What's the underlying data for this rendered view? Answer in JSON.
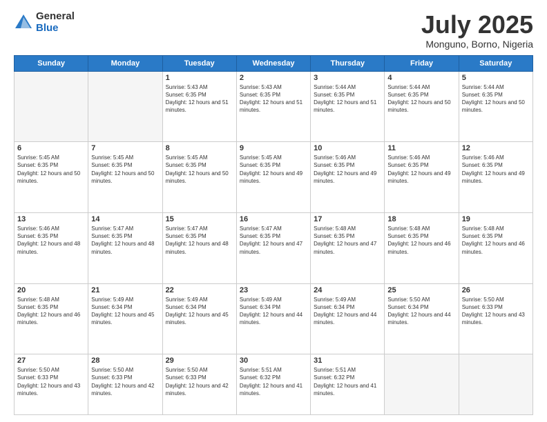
{
  "header": {
    "logo_general": "General",
    "logo_blue": "Blue",
    "month_title": "July 2025",
    "location": "Monguno, Borno, Nigeria"
  },
  "calendar": {
    "days_of_week": [
      "Sunday",
      "Monday",
      "Tuesday",
      "Wednesday",
      "Thursday",
      "Friday",
      "Saturday"
    ],
    "weeks": [
      [
        {
          "day": "",
          "sunrise": "",
          "sunset": "",
          "daylight": "",
          "empty": true
        },
        {
          "day": "",
          "sunrise": "",
          "sunset": "",
          "daylight": "",
          "empty": true
        },
        {
          "day": "1",
          "sunrise": "Sunrise: 5:43 AM",
          "sunset": "Sunset: 6:35 PM",
          "daylight": "Daylight: 12 hours and 51 minutes.",
          "empty": false
        },
        {
          "day": "2",
          "sunrise": "Sunrise: 5:43 AM",
          "sunset": "Sunset: 6:35 PM",
          "daylight": "Daylight: 12 hours and 51 minutes.",
          "empty": false
        },
        {
          "day": "3",
          "sunrise": "Sunrise: 5:44 AM",
          "sunset": "Sunset: 6:35 PM",
          "daylight": "Daylight: 12 hours and 51 minutes.",
          "empty": false
        },
        {
          "day": "4",
          "sunrise": "Sunrise: 5:44 AM",
          "sunset": "Sunset: 6:35 PM",
          "daylight": "Daylight: 12 hours and 50 minutes.",
          "empty": false
        },
        {
          "day": "5",
          "sunrise": "Sunrise: 5:44 AM",
          "sunset": "Sunset: 6:35 PM",
          "daylight": "Daylight: 12 hours and 50 minutes.",
          "empty": false
        }
      ],
      [
        {
          "day": "6",
          "sunrise": "Sunrise: 5:45 AM",
          "sunset": "Sunset: 6:35 PM",
          "daylight": "Daylight: 12 hours and 50 minutes.",
          "empty": false
        },
        {
          "day": "7",
          "sunrise": "Sunrise: 5:45 AM",
          "sunset": "Sunset: 6:35 PM",
          "daylight": "Daylight: 12 hours and 50 minutes.",
          "empty": false
        },
        {
          "day": "8",
          "sunrise": "Sunrise: 5:45 AM",
          "sunset": "Sunset: 6:35 PM",
          "daylight": "Daylight: 12 hours and 50 minutes.",
          "empty": false
        },
        {
          "day": "9",
          "sunrise": "Sunrise: 5:45 AM",
          "sunset": "Sunset: 6:35 PM",
          "daylight": "Daylight: 12 hours and 49 minutes.",
          "empty": false
        },
        {
          "day": "10",
          "sunrise": "Sunrise: 5:46 AM",
          "sunset": "Sunset: 6:35 PM",
          "daylight": "Daylight: 12 hours and 49 minutes.",
          "empty": false
        },
        {
          "day": "11",
          "sunrise": "Sunrise: 5:46 AM",
          "sunset": "Sunset: 6:35 PM",
          "daylight": "Daylight: 12 hours and 49 minutes.",
          "empty": false
        },
        {
          "day": "12",
          "sunrise": "Sunrise: 5:46 AM",
          "sunset": "Sunset: 6:35 PM",
          "daylight": "Daylight: 12 hours and 49 minutes.",
          "empty": false
        }
      ],
      [
        {
          "day": "13",
          "sunrise": "Sunrise: 5:46 AM",
          "sunset": "Sunset: 6:35 PM",
          "daylight": "Daylight: 12 hours and 48 minutes.",
          "empty": false
        },
        {
          "day": "14",
          "sunrise": "Sunrise: 5:47 AM",
          "sunset": "Sunset: 6:35 PM",
          "daylight": "Daylight: 12 hours and 48 minutes.",
          "empty": false
        },
        {
          "day": "15",
          "sunrise": "Sunrise: 5:47 AM",
          "sunset": "Sunset: 6:35 PM",
          "daylight": "Daylight: 12 hours and 48 minutes.",
          "empty": false
        },
        {
          "day": "16",
          "sunrise": "Sunrise: 5:47 AM",
          "sunset": "Sunset: 6:35 PM",
          "daylight": "Daylight: 12 hours and 47 minutes.",
          "empty": false
        },
        {
          "day": "17",
          "sunrise": "Sunrise: 5:48 AM",
          "sunset": "Sunset: 6:35 PM",
          "daylight": "Daylight: 12 hours and 47 minutes.",
          "empty": false
        },
        {
          "day": "18",
          "sunrise": "Sunrise: 5:48 AM",
          "sunset": "Sunset: 6:35 PM",
          "daylight": "Daylight: 12 hours and 46 minutes.",
          "empty": false
        },
        {
          "day": "19",
          "sunrise": "Sunrise: 5:48 AM",
          "sunset": "Sunset: 6:35 PM",
          "daylight": "Daylight: 12 hours and 46 minutes.",
          "empty": false
        }
      ],
      [
        {
          "day": "20",
          "sunrise": "Sunrise: 5:48 AM",
          "sunset": "Sunset: 6:35 PM",
          "daylight": "Daylight: 12 hours and 46 minutes.",
          "empty": false
        },
        {
          "day": "21",
          "sunrise": "Sunrise: 5:49 AM",
          "sunset": "Sunset: 6:34 PM",
          "daylight": "Daylight: 12 hours and 45 minutes.",
          "empty": false
        },
        {
          "day": "22",
          "sunrise": "Sunrise: 5:49 AM",
          "sunset": "Sunset: 6:34 PM",
          "daylight": "Daylight: 12 hours and 45 minutes.",
          "empty": false
        },
        {
          "day": "23",
          "sunrise": "Sunrise: 5:49 AM",
          "sunset": "Sunset: 6:34 PM",
          "daylight": "Daylight: 12 hours and 44 minutes.",
          "empty": false
        },
        {
          "day": "24",
          "sunrise": "Sunrise: 5:49 AM",
          "sunset": "Sunset: 6:34 PM",
          "daylight": "Daylight: 12 hours and 44 minutes.",
          "empty": false
        },
        {
          "day": "25",
          "sunrise": "Sunrise: 5:50 AM",
          "sunset": "Sunset: 6:34 PM",
          "daylight": "Daylight: 12 hours and 44 minutes.",
          "empty": false
        },
        {
          "day": "26",
          "sunrise": "Sunrise: 5:50 AM",
          "sunset": "Sunset: 6:33 PM",
          "daylight": "Daylight: 12 hours and 43 minutes.",
          "empty": false
        }
      ],
      [
        {
          "day": "27",
          "sunrise": "Sunrise: 5:50 AM",
          "sunset": "Sunset: 6:33 PM",
          "daylight": "Daylight: 12 hours and 43 minutes.",
          "empty": false
        },
        {
          "day": "28",
          "sunrise": "Sunrise: 5:50 AM",
          "sunset": "Sunset: 6:33 PM",
          "daylight": "Daylight: 12 hours and 42 minutes.",
          "empty": false
        },
        {
          "day": "29",
          "sunrise": "Sunrise: 5:50 AM",
          "sunset": "Sunset: 6:33 PM",
          "daylight": "Daylight: 12 hours and 42 minutes.",
          "empty": false
        },
        {
          "day": "30",
          "sunrise": "Sunrise: 5:51 AM",
          "sunset": "Sunset: 6:32 PM",
          "daylight": "Daylight: 12 hours and 41 minutes.",
          "empty": false
        },
        {
          "day": "31",
          "sunrise": "Sunrise: 5:51 AM",
          "sunset": "Sunset: 6:32 PM",
          "daylight": "Daylight: 12 hours and 41 minutes.",
          "empty": false
        },
        {
          "day": "",
          "sunrise": "",
          "sunset": "",
          "daylight": "",
          "empty": true
        },
        {
          "day": "",
          "sunrise": "",
          "sunset": "",
          "daylight": "",
          "empty": true
        }
      ]
    ]
  }
}
